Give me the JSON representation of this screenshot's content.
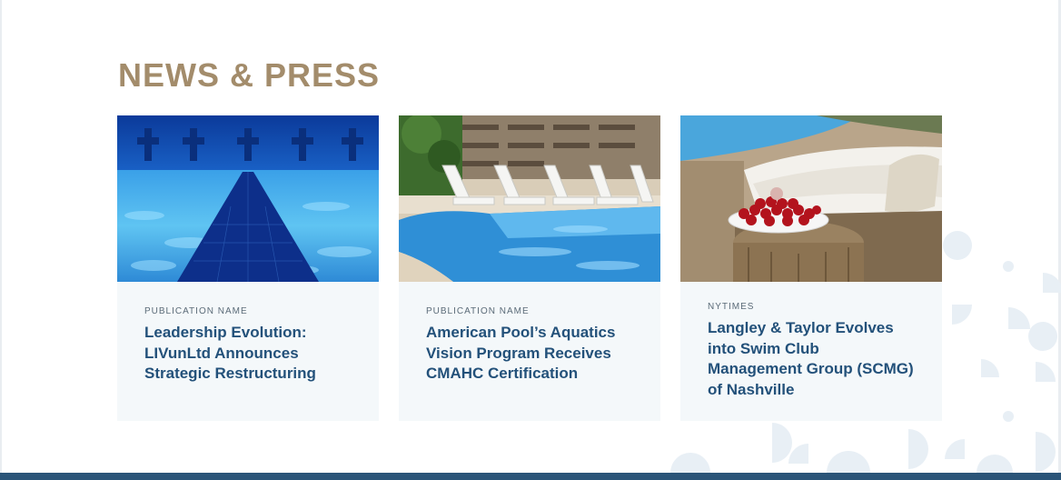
{
  "section": {
    "title": "NEWS & PRESS"
  },
  "cards": [
    {
      "image": "swimming-pool-lane-underwater-photo",
      "source": "PUBLICATION NAME",
      "headline": "Leadership Evolution: LIVunLtd Announces Strategic Restructuring"
    },
    {
      "image": "resort-pool-lounge-chairs-photo",
      "source": "PUBLICATION NAME",
      "headline": "American Pool’s Aquatics Vision Program Receives CMAHC Certification"
    },
    {
      "image": "poolside-daybed-cherries-photo",
      "source": "NYTIMES",
      "headline": "Langley & Taylor Evolves into Swim Club Management Group (SCMG) of Nashville"
    }
  ],
  "colors": {
    "title": "#a38c6b",
    "headline": "#23517a",
    "card_background": "#f4f8fa",
    "bottom_bar": "#2a5478",
    "pattern": "#e8eff5"
  }
}
